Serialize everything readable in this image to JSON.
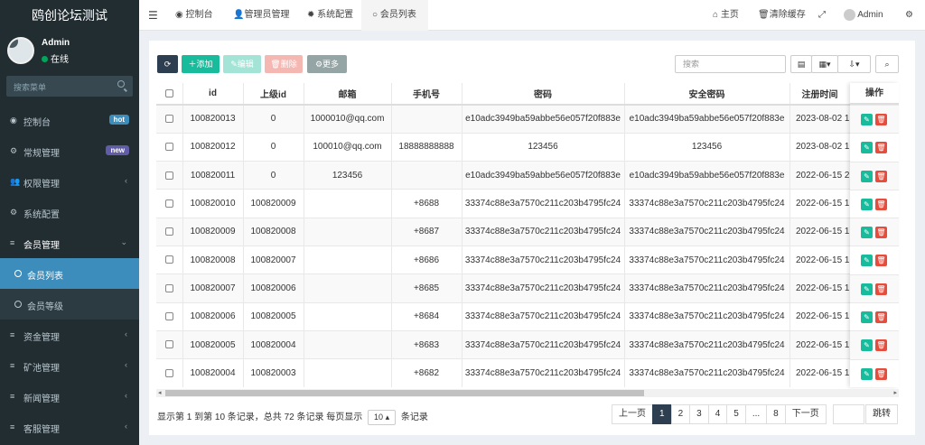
{
  "app_title": "鸥创论坛测试",
  "user": {
    "name": "Admin",
    "status": "在线"
  },
  "sidebar_search_placeholder": "搜索菜单",
  "menu": [
    {
      "label": "控制台",
      "icon": "dashboard-icon",
      "badge": "hot",
      "badge_color": "#3c8dbc"
    },
    {
      "label": "常规管理",
      "icon": "cogs-icon",
      "badge": "new",
      "badge_color": "#605ca8"
    },
    {
      "label": "权限管理",
      "icon": "group-icon",
      "chevron": "‹"
    },
    {
      "label": "系统配置",
      "icon": "gear-icon"
    },
    {
      "label": "会员管理",
      "icon": "list-icon",
      "chevron": "⌄",
      "open": true
    },
    {
      "label": "会员列表",
      "icon": "circle-icon",
      "active": true
    },
    {
      "label": "会员等级",
      "icon": "circle-icon",
      "sub": true
    },
    {
      "label": "资金管理",
      "icon": "list-icon",
      "chevron": "‹"
    },
    {
      "label": "矿池管理",
      "icon": "list-icon",
      "chevron": "‹"
    },
    {
      "label": "新闻管理",
      "icon": "list-icon",
      "chevron": "‹"
    },
    {
      "label": "客服管理",
      "icon": "list-icon",
      "chevron": "‹"
    }
  ],
  "topbar": {
    "tabs": [
      "控制台",
      "管理员管理",
      "系统配置",
      "会员列表"
    ],
    "right": {
      "home": "主页",
      "clear_cache": "清除缓存",
      "admin": "Admin"
    }
  },
  "toolbar": {
    "refresh": "",
    "add": "添加",
    "edit": "编辑",
    "delete": "删除",
    "more": "更多",
    "search_placeholder": "搜索"
  },
  "table": {
    "columns": [
      "id",
      "上级id",
      "邮箱",
      "手机号",
      "密码",
      "安全密码",
      "注册时间"
    ],
    "ops_header": "操作",
    "rows": [
      [
        "100820013",
        "0",
        "1000010@qq.com",
        "",
        "e10adc3949ba59abbe56e057f20f883e",
        "e10adc3949ba59abbe56e057f20f883e",
        "2023-08-02 1"
      ],
      [
        "100820012",
        "0",
        "100010@qq.com",
        "18888888888",
        "123456",
        "123456",
        "2023-08-02 1"
      ],
      [
        "100820011",
        "0",
        "123456",
        "",
        "e10adc3949ba59abbe56e057f20f883e",
        "e10adc3949ba59abbe56e057f20f883e",
        "2022-06-15 2"
      ],
      [
        "100820010",
        "100820009",
        "",
        "+8688",
        "33374c88e3a7570c211c203b4795fc24",
        "33374c88e3a7570c211c203b4795fc24",
        "2022-06-15 1"
      ],
      [
        "100820009",
        "100820008",
        "",
        "+8687",
        "33374c88e3a7570c211c203b4795fc24",
        "33374c88e3a7570c211c203b4795fc24",
        "2022-06-15 1"
      ],
      [
        "100820008",
        "100820007",
        "",
        "+8686",
        "33374c88e3a7570c211c203b4795fc24",
        "33374c88e3a7570c211c203b4795fc24",
        "2022-06-15 1"
      ],
      [
        "100820007",
        "100820006",
        "",
        "+8685",
        "33374c88e3a7570c211c203b4795fc24",
        "33374c88e3a7570c211c203b4795fc24",
        "2022-06-15 1"
      ],
      [
        "100820006",
        "100820005",
        "",
        "+8684",
        "33374c88e3a7570c211c203b4795fc24",
        "33374c88e3a7570c211c203b4795fc24",
        "2022-06-15 1"
      ],
      [
        "100820005",
        "100820004",
        "",
        "+8683",
        "33374c88e3a7570c211c203b4795fc24",
        "33374c88e3a7570c211c203b4795fc24",
        "2022-06-15 1"
      ],
      [
        "100820004",
        "100820003",
        "",
        "+8682",
        "33374c88e3a7570c211c203b4795fc24",
        "33374c88e3a7570c211c203b4795fc24",
        "2022-06-15 1"
      ]
    ]
  },
  "footer": {
    "info_prefix": "显示第 1 到第 10 条记录，总共 72 条记录 每页显示",
    "page_size": "10",
    "info_suffix": "条记录",
    "pages": [
      "上一页",
      "1",
      "2",
      "3",
      "4",
      "5",
      "...",
      "8",
      "下一页"
    ],
    "jump": "跳转"
  },
  "colors": {
    "sidebar": "#222d32",
    "active": "#3c8dbc",
    "add": "#18bc9c",
    "delete": "#e74c3c",
    "more": "#95a5a6",
    "refresh": "#2c3e50"
  }
}
